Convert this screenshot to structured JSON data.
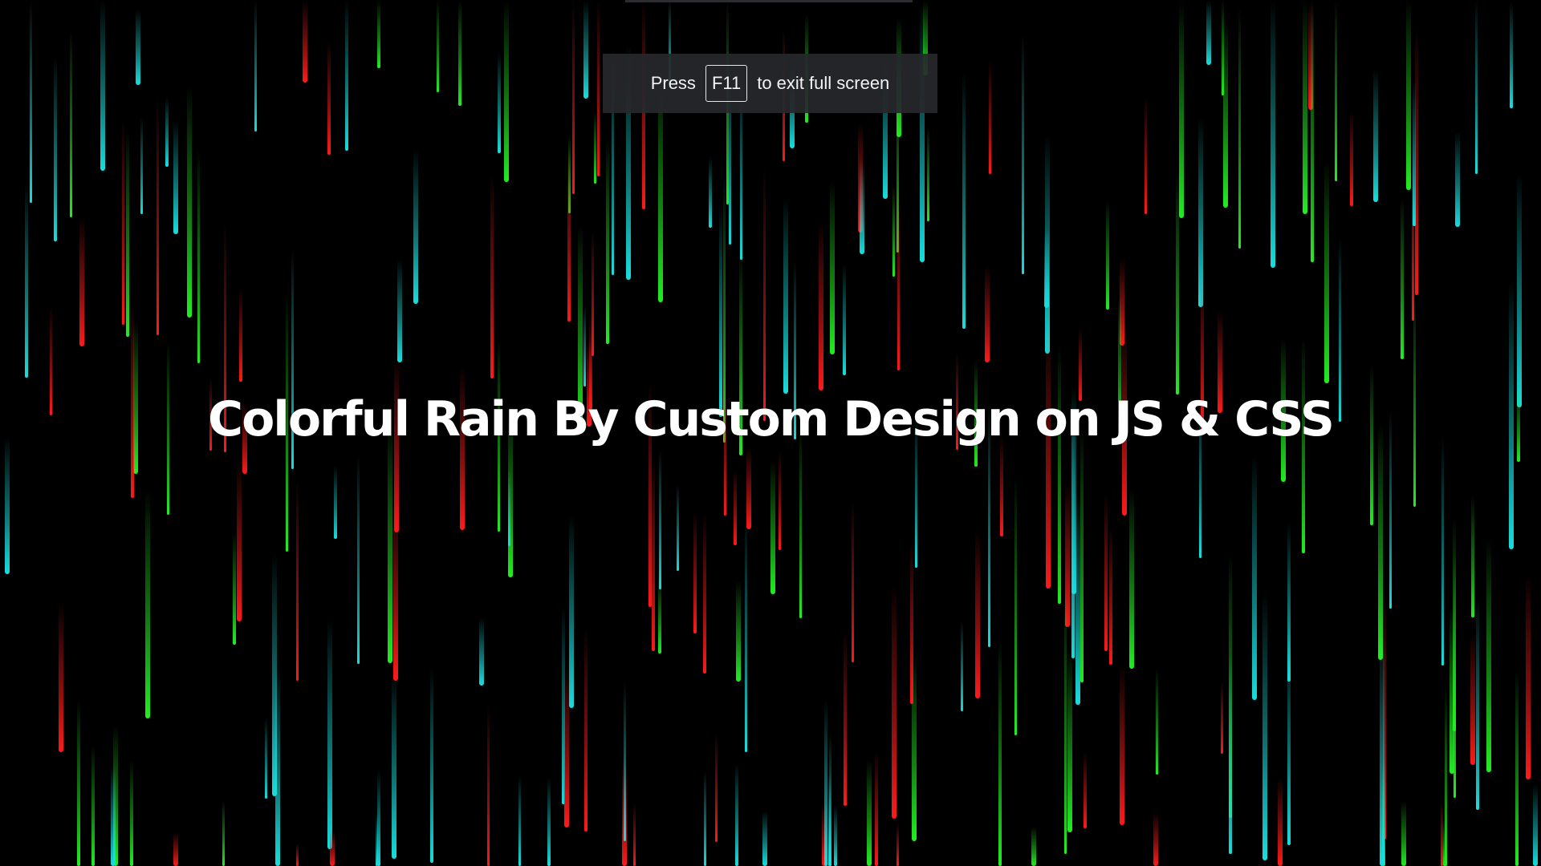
{
  "page": {
    "title": "Colorful Rain By Custom Design on JS & CSS",
    "background_color": "#000000"
  },
  "fullscreen_notice": {
    "prefix": "Press",
    "key": "F11",
    "suffix": "to exit full screen"
  },
  "rain": {
    "colors": [
      "#ff1a1a",
      "#22ee22",
      "#19dede"
    ]
  }
}
